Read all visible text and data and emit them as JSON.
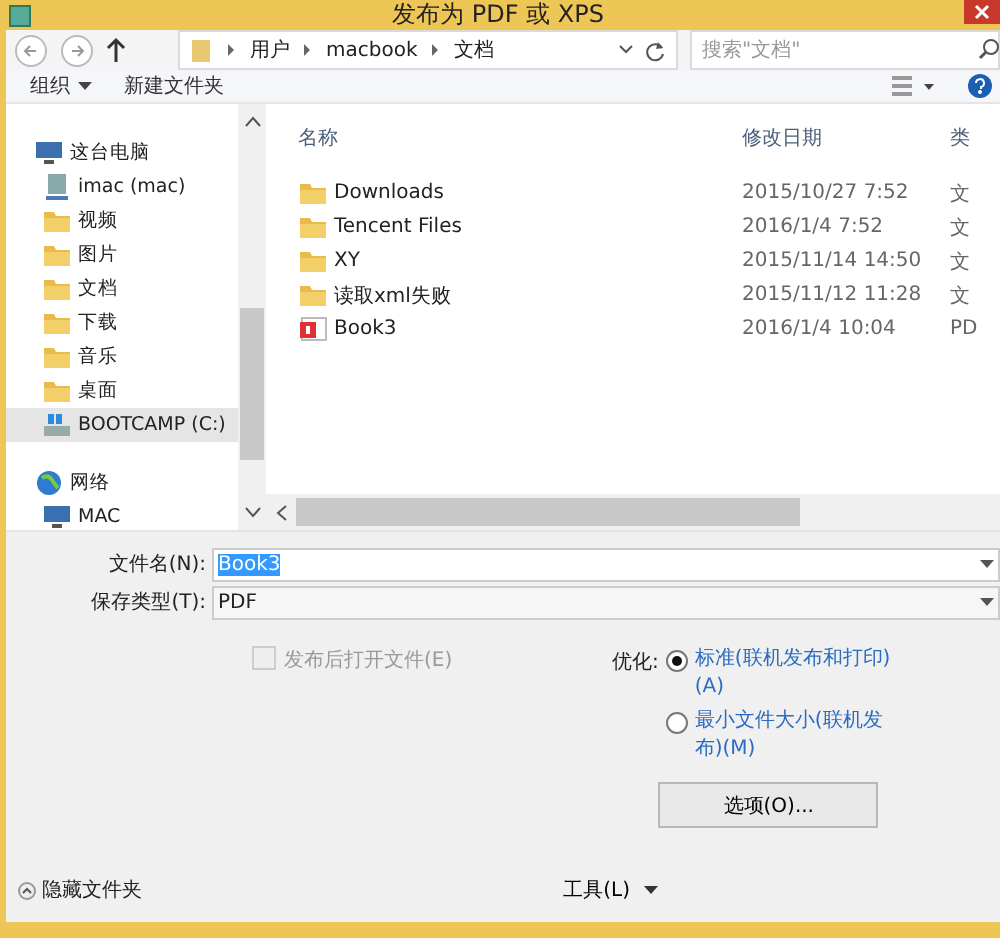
{
  "window": {
    "title": "发布为 PDF 或 XPS"
  },
  "address_bar": {
    "path": [
      "用户",
      "macbook",
      "文档"
    ],
    "search": {
      "placeholder": "搜索\"文档\""
    }
  },
  "toolbar": {
    "organize": "组织",
    "new_folder": "新建文件夹"
  },
  "navigation": {
    "items": [
      {
        "label": "这台电脑",
        "kind": "computer",
        "selected": false,
        "children": [
          {
            "label": "imac (mac)",
            "kind": "netdrive",
            "selected": false
          },
          {
            "label": "视频",
            "kind": "folder",
            "selected": false
          },
          {
            "label": "图片",
            "kind": "folder",
            "selected": false
          },
          {
            "label": "文档",
            "kind": "folder",
            "selected": false
          },
          {
            "label": "下载",
            "kind": "folder",
            "selected": false
          },
          {
            "label": "音乐",
            "kind": "folder",
            "selected": false
          },
          {
            "label": "桌面",
            "kind": "folder",
            "selected": false
          },
          {
            "label": "BOOTCAMP (C:)",
            "kind": "drive",
            "selected": true
          }
        ]
      },
      {
        "label": "网络",
        "kind": "network",
        "selected": false,
        "children": [
          {
            "label": "MAC",
            "kind": "computer",
            "selected": false
          }
        ]
      }
    ]
  },
  "file_list": {
    "columns": [
      "名称",
      "修改日期",
      "类"
    ],
    "rows": [
      {
        "name": "Downloads",
        "modified": "2015/10/27 7:52",
        "type": "文",
        "kind": "folder"
      },
      {
        "name": "Tencent Files",
        "modified": "2016/1/4 7:52",
        "type": "文",
        "kind": "folder"
      },
      {
        "name": "XY",
        "modified": "2015/11/14 14:50",
        "type": "文",
        "kind": "folder"
      },
      {
        "name": "读取xml失败",
        "modified": "2015/11/12 11:28",
        "type": "文",
        "kind": "folder"
      },
      {
        "name": "Book3",
        "modified": "2016/1/4 10:04",
        "type": "PD",
        "kind": "pdf"
      }
    ]
  },
  "form": {
    "file_name": {
      "label": "文件名(N):",
      "value": "Book3",
      "selected": true
    },
    "save_type": {
      "label": "保存类型(T):",
      "value": "PDF"
    },
    "open_after": {
      "label": "发布后打开文件(E)",
      "checked": false,
      "disabled": true
    },
    "optimize": {
      "label": "优化:",
      "options": [
        {
          "label": "标准(联机发布和打印)(A)",
          "selected": true
        },
        {
          "label": "最小文件大小(联机发布)(M)",
          "selected": false
        }
      ]
    },
    "options_button": "选项(O)...",
    "hide_folders": "隐藏文件夹",
    "tools": "工具(L)"
  }
}
